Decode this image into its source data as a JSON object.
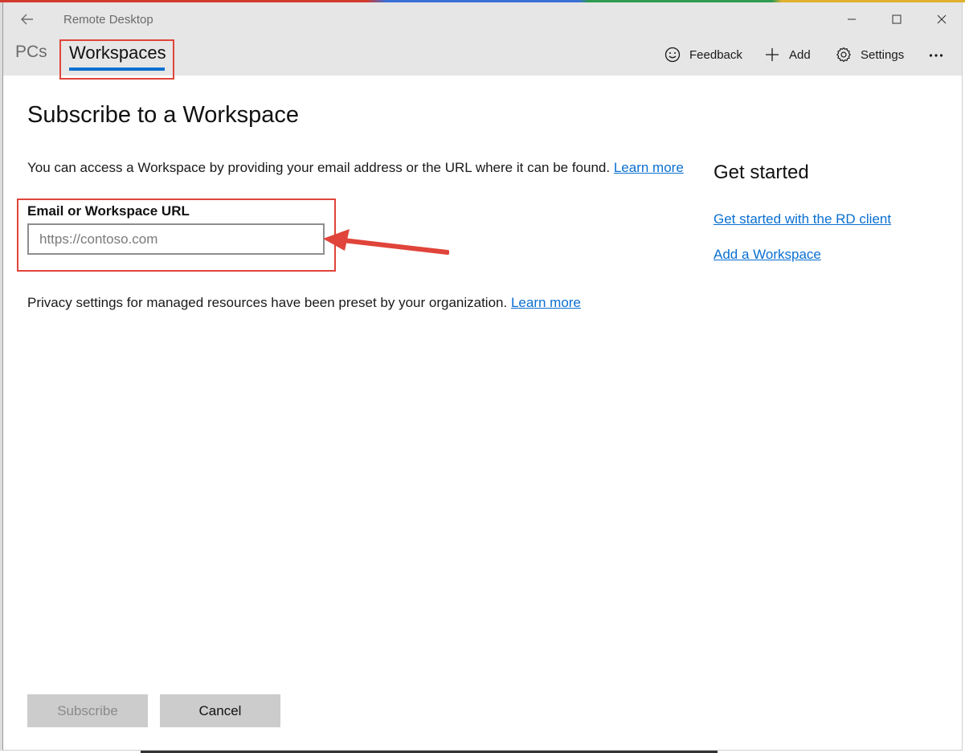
{
  "window": {
    "title": "Remote Desktop"
  },
  "tabs": {
    "pcs": "PCs",
    "workspaces": "Workspaces"
  },
  "toolbar": {
    "feedback": "Feedback",
    "add": "Add",
    "settings": "Settings"
  },
  "icons": {
    "back": "back-arrow-icon",
    "minimize": "minimize-icon",
    "maximize": "maximize-icon",
    "close": "close-icon",
    "feedback": "smiley-icon",
    "add": "plus-icon",
    "settings": "gear-icon",
    "more": "more-icon"
  },
  "main": {
    "title": "Subscribe to a Workspace",
    "intro": "You can access a Workspace by providing your email address or the URL where it can be found.",
    "intro_link": "Learn more",
    "field_label": "Email or Workspace URL",
    "field_value": "",
    "field_placeholder": "https://contoso.com",
    "privacy": "Privacy settings for managed resources have been preset by your organization.",
    "privacy_link": "Learn more"
  },
  "sidebar": {
    "title": "Get started",
    "links": [
      "Get started with the RD client",
      "Add a Workspace"
    ]
  },
  "buttons": {
    "subscribe": "Subscribe",
    "cancel": "Cancel"
  },
  "colors": {
    "accent": "#0a6fd1",
    "highlight": "#e0443a",
    "titlebar": "#e6e6e6"
  }
}
